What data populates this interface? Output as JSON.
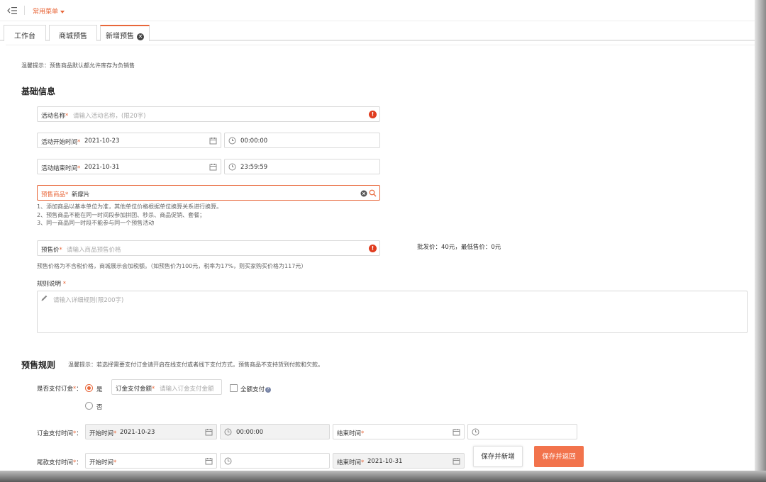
{
  "topbar": {
    "favorites_label": "常用菜单"
  },
  "tabs": [
    {
      "label": "工作台"
    },
    {
      "label": "商城预售"
    },
    {
      "label": "新增预售",
      "close": "✕"
    }
  ],
  "page": {
    "tip": "温馨提示：预售商品默认都允许库存为负销售",
    "basic_title": "基础信息",
    "required_mark": "*",
    "activity_name": {
      "label": "活动名称",
      "placeholder": "请输入活动名称，(限20字)"
    },
    "start": {
      "label": "活动开始时间",
      "date": "2021-10-23",
      "time": "00:00:00"
    },
    "end": {
      "label": "活动结束时间",
      "date": "2021-10-31",
      "time": "23:59:59"
    },
    "product": {
      "label": "预售商品",
      "value": "新摩片"
    },
    "product_notes": [
      "1、添加商品以基本单位为准，其他单位价格根据单位换算关系进行换算。",
      "2、预售商品不能在同一时间段参加拼团、秒杀、商品促销、套餐；",
      "3、同一商品同一时段不能参与同一个预售活动"
    ],
    "price": {
      "label": "预售价",
      "placeholder": "请输入商品预售价格"
    },
    "price_info": "批发价：40元，最低售价：0元",
    "price_note": "预售价格为不含税价格，商城展示会加税额。（如预售价为100元，税率为17%，则买家购买价格为117元）",
    "rules": {
      "label": "规则说明",
      "placeholder": "请输入详细规则(限200字)"
    },
    "presale_title": "预售规则",
    "presale_tip": "温馨提示：若选择需要支付订金请开启在线支付或者线下支付方式，预售商品不支持货到付款和欠款。",
    "deposit": {
      "label": "是否支付订金",
      "label_suffix": "：",
      "yes": "是",
      "no": "否",
      "amount_label": "订金支付金额",
      "amount_placeholder": "请输入订金支付金额",
      "full_pay": "全额支付",
      "help": "?"
    },
    "deposit_time": {
      "label": "订金支付时间",
      "start_label": "开始时间",
      "start_date": "2021-10-23",
      "start_time": "00:00:00",
      "end_label": "结束时间"
    },
    "balance_time": {
      "label": "尾款支付时间",
      "start_label": "开始时间",
      "end_label": "结束时间",
      "end_date": "2021-10-31"
    }
  },
  "buttons": {
    "save_new": "保存并新增",
    "save_return": "保存并返回"
  },
  "colors": {
    "accent": "#e8673a",
    "primary_button": "#f2734c",
    "error": "#e03c1f"
  }
}
